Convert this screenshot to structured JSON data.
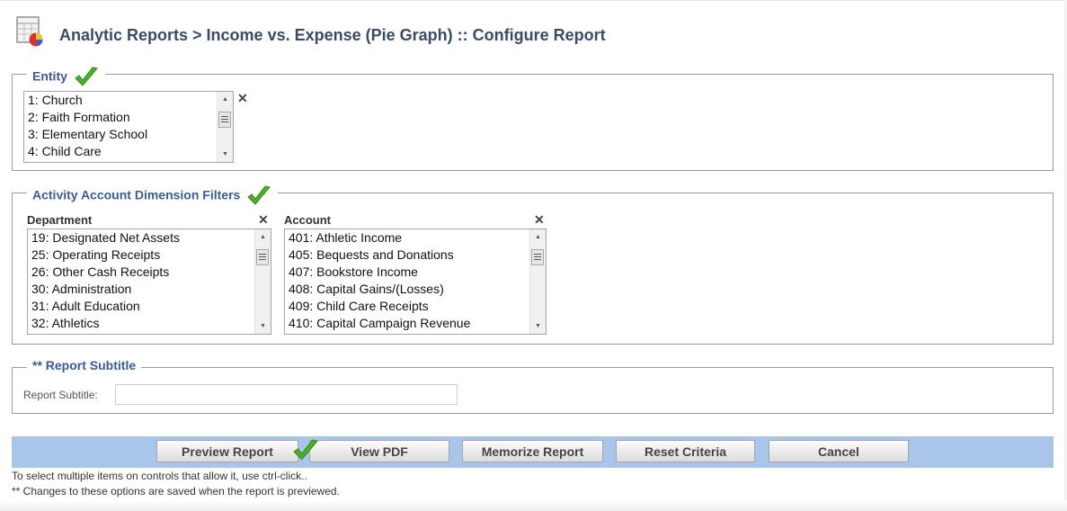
{
  "header": {
    "title": "Analytic Reports > Income vs. Expense (Pie Graph) :: Configure Report",
    "icon": "report-pie-icon"
  },
  "entity": {
    "legend": "Entity",
    "items": [
      "1: Church",
      "2: Faith Formation",
      "3: Elementary School",
      "4: Child Care"
    ]
  },
  "filters": {
    "legend": "Activity Account Dimension Filters",
    "department": {
      "label": "Department",
      "items": [
        "19: Designated Net Assets",
        "25: Operating Receipts",
        "26: Other Cash Receipts",
        "30: Administration",
        "31: Adult Education",
        "32: Athletics"
      ]
    },
    "account": {
      "label": "Account",
      "items": [
        "401: Athletic Income",
        "405: Bequests and Donations",
        "407: Bookstore Income",
        "408: Capital Gains/(Losses)",
        "409: Child Care Receipts",
        "410: Capital Campaign Revenue"
      ]
    }
  },
  "subtitle": {
    "legend": "** Report Subtitle",
    "field_label": "Report Subtitle:",
    "value": ""
  },
  "buttons": {
    "preview": "Preview Report",
    "view_pdf": "View PDF",
    "memorize": "Memorize Report",
    "reset": "Reset Criteria",
    "cancel": "Cancel"
  },
  "notes": {
    "line1": "To select multiple items on controls that allow it, use ctrl-click..",
    "line2": "** Changes to these options are saved when the report is previewed."
  },
  "colors": {
    "title": "#3b4a6b",
    "legend": "#3b5a96",
    "button_bar": "#a9c5ea",
    "check": "#4caf2a"
  }
}
